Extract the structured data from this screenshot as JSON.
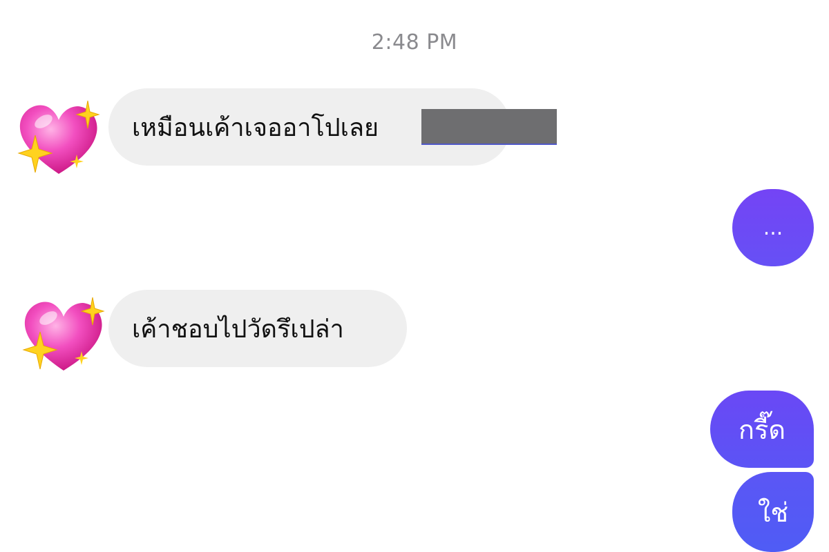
{
  "conversation": {
    "timestamp": "2:48 PM",
    "messages": [
      {
        "sender": "contact",
        "avatar_icon": "sparkling-heart-icon",
        "text": "เหมือนเค้าเจออาโปเลย",
        "has_redaction": true
      },
      {
        "sender": "me",
        "text": "..."
      },
      {
        "sender": "contact",
        "avatar_icon": "sparkling-heart-icon",
        "text": "เค้าชอบไปวัดรึเปล่า"
      },
      {
        "sender": "me",
        "text": "กรี๊ด"
      },
      {
        "sender": "me",
        "text": "ใช่"
      }
    ]
  },
  "colors": {
    "incoming_bubble": "#efefef",
    "outgoing_gradient_top": "#7444f5",
    "outgoing_gradient_bottom": "#4f5cf5",
    "timestamp": "#8a8a8e",
    "redaction": "#6e6e70"
  }
}
